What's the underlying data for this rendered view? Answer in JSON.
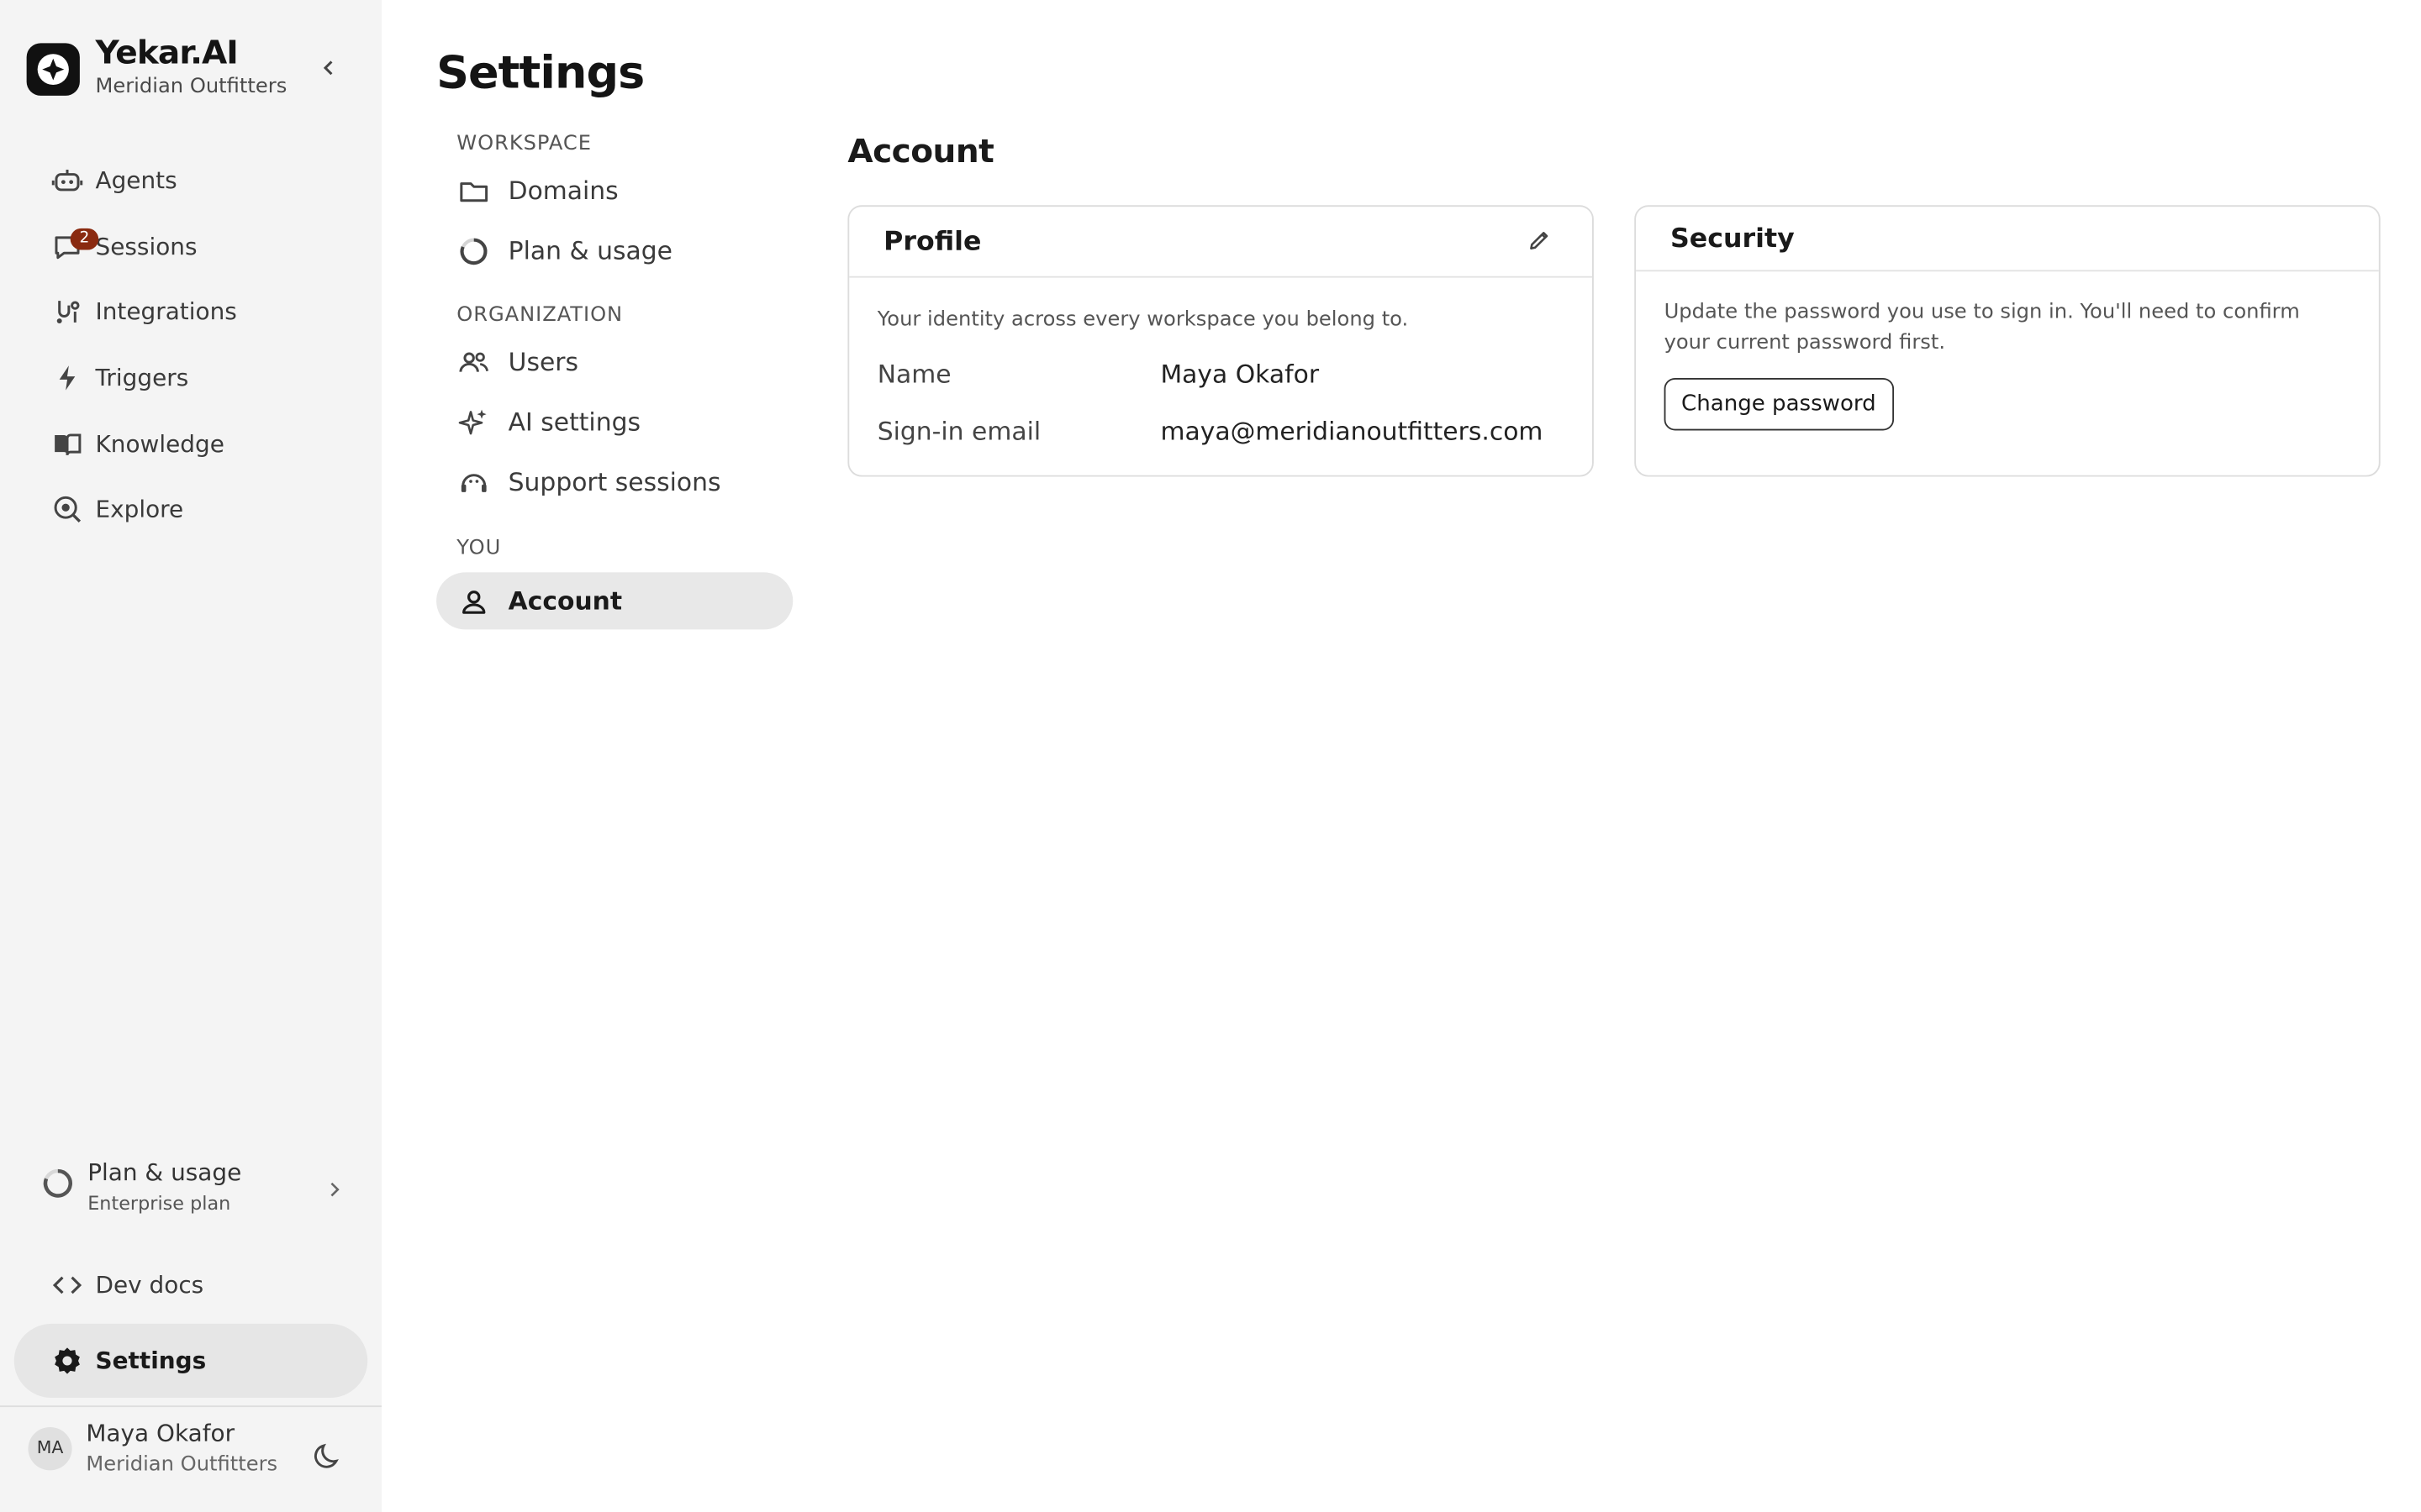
{
  "brand": {
    "name": "Yekar.AI",
    "org": "Meridian Outfitters"
  },
  "nav": {
    "items": [
      {
        "label": "Agents",
        "icon": "robot-icon"
      },
      {
        "label": "Sessions",
        "icon": "chat-icon",
        "badge": "2"
      },
      {
        "label": "Integrations",
        "icon": "integrations-icon"
      },
      {
        "label": "Triggers",
        "icon": "bolt-icon"
      },
      {
        "label": "Knowledge",
        "icon": "book-icon"
      },
      {
        "label": "Explore",
        "icon": "explore-icon"
      }
    ]
  },
  "plan": {
    "title": "Plan & usage",
    "subtitle": "Enterprise plan"
  },
  "devdocs": {
    "label": "Dev docs"
  },
  "settings_nav": {
    "label": "Settings"
  },
  "user": {
    "initials": "MA",
    "name": "Maya Okafor",
    "org": "Meridian Outfitters"
  },
  "page": {
    "title": "Settings"
  },
  "subnav": {
    "workspace_label": "WORKSPACE",
    "domains": "Domains",
    "plan_usage": "Plan & usage",
    "organization_label": "ORGANIZATION",
    "users": "Users",
    "ai_settings": "AI settings",
    "support_sessions": "Support sessions",
    "you_label": "YOU",
    "account": "Account"
  },
  "account": {
    "title": "Account",
    "profile": {
      "title": "Profile",
      "description": "Your identity across every workspace you belong to.",
      "name_label": "Name",
      "name_value": "Maya Okafor",
      "email_label": "Sign-in email",
      "email_value": "maya@meridianoutfitters.com"
    },
    "security": {
      "title": "Security",
      "description": "Update the password you use to sign in. You'll need to confirm your current password first.",
      "button": "Change password"
    }
  },
  "colors": {
    "badge": "#8a2a10",
    "active_bg": "#e6e6e6",
    "sidebar_bg": "#f4f4f4"
  }
}
